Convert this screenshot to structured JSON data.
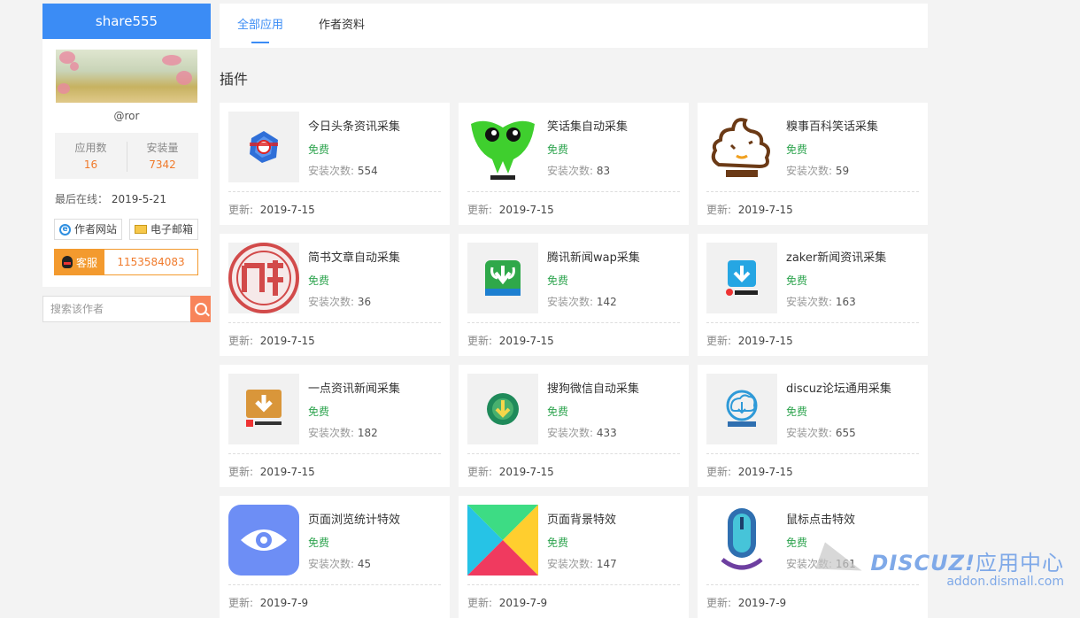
{
  "author": {
    "name": "share555",
    "handle": "@ror",
    "stats": [
      {
        "label": "应用数",
        "value": "16"
      },
      {
        "label": "安装量",
        "value": "7342"
      }
    ],
    "last_online_label": "最后在线：",
    "last_online_value": "2019-5-21",
    "website_label": "作者网站",
    "email_label": "电子邮箱",
    "service_label": "客服",
    "service_number": "1153584083",
    "search_placeholder": "搜索该作者"
  },
  "tabs": [
    {
      "label": "全部应用",
      "active": true
    },
    {
      "label": "作者资料",
      "active": false
    }
  ],
  "section_title": "插件",
  "labels": {
    "installs": "安装次数:",
    "update": "更新:"
  },
  "plugins": [
    {
      "title": "今日头条资讯采集",
      "price": "免费",
      "installs": "554",
      "updated": "2019-7-15",
      "icon": "toutiao-icon"
    },
    {
      "title": "笑话集自动采集",
      "price": "免费",
      "installs": "83",
      "updated": "2019-7-15",
      "icon": "xiaohuaji-icon"
    },
    {
      "title": "糗事百科笑话采集",
      "price": "免费",
      "installs": "59",
      "updated": "2019-7-15",
      "icon": "qiushibaike-icon"
    },
    {
      "title": "简书文章自动采集",
      "price": "免费",
      "installs": "36",
      "updated": "2019-7-15",
      "icon": "jianshu-icon"
    },
    {
      "title": "腾讯新闻wap采集",
      "price": "免费",
      "installs": "142",
      "updated": "2019-7-15",
      "icon": "tencent-news-icon"
    },
    {
      "title": "zaker新闻资讯采集",
      "price": "免费",
      "installs": "163",
      "updated": "2019-7-15",
      "icon": "zaker-icon"
    },
    {
      "title": "一点资讯新闻采集",
      "price": "免费",
      "installs": "182",
      "updated": "2019-7-15",
      "icon": "yidian-icon"
    },
    {
      "title": "搜狗微信自动采集",
      "price": "免费",
      "installs": "433",
      "updated": "2019-7-15",
      "icon": "sogou-weixin-icon"
    },
    {
      "title": "discuz论坛通用采集",
      "price": "免费",
      "installs": "655",
      "updated": "2019-7-15",
      "icon": "discuz-icon"
    },
    {
      "title": "页面浏览统计特效",
      "price": "免费",
      "installs": "45",
      "updated": "2019-7-9",
      "icon": "eye-icon"
    },
    {
      "title": "页面背景特效",
      "price": "免费",
      "installs": "147",
      "updated": "2019-7-9",
      "icon": "play-triangle-icon"
    },
    {
      "title": "鼠标点击特效",
      "price": "免费",
      "installs": "161",
      "updated": "2019-7-9",
      "icon": "mouse-icon"
    }
  ],
  "watermark": {
    "brand": "DISCUZ!",
    "brand_cn": "应用中心",
    "url": "addon.dismall.com"
  }
}
